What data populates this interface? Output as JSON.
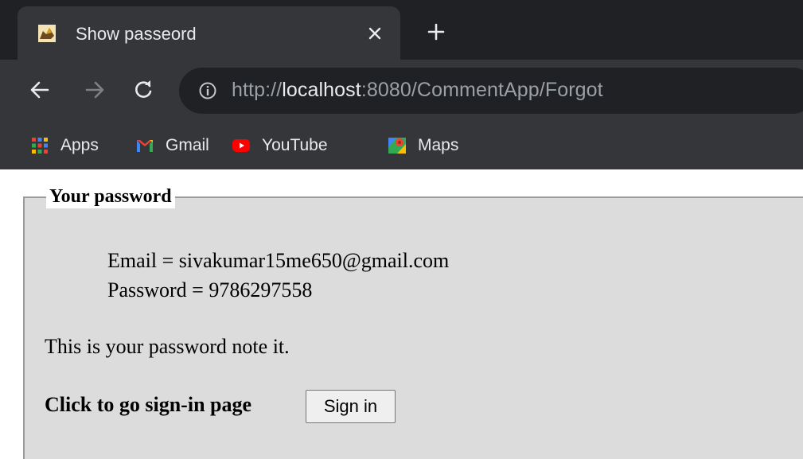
{
  "browser": {
    "tab": {
      "title": "Show passeord",
      "favicon": "tomcat-icon"
    },
    "omnibox": {
      "scheme": "http://",
      "host": "localhost",
      "rest": ":8080/CommentApp/Forgot"
    },
    "bookmarks": [
      {
        "label": "Apps",
        "icon": "apps-grid-icon"
      },
      {
        "label": "Gmail",
        "icon": "gmail-icon"
      },
      {
        "label": "YouTube",
        "icon": "youtube-icon"
      },
      {
        "label": "Maps",
        "icon": "maps-icon"
      }
    ],
    "colors": {
      "tabstrip_bg": "#202124",
      "toolbar_bg": "#35363a",
      "text": "#e8eaed"
    }
  },
  "page": {
    "legend": "Your password",
    "email_line": "Email = sivakumar15me650@gmail.com",
    "password_line": "Password = 9786297558",
    "note": "This is your password note it.",
    "cta_text": "Click to go sign-in page",
    "signin_button": "Sign in",
    "fieldset_bg": "#dcdcdc"
  }
}
